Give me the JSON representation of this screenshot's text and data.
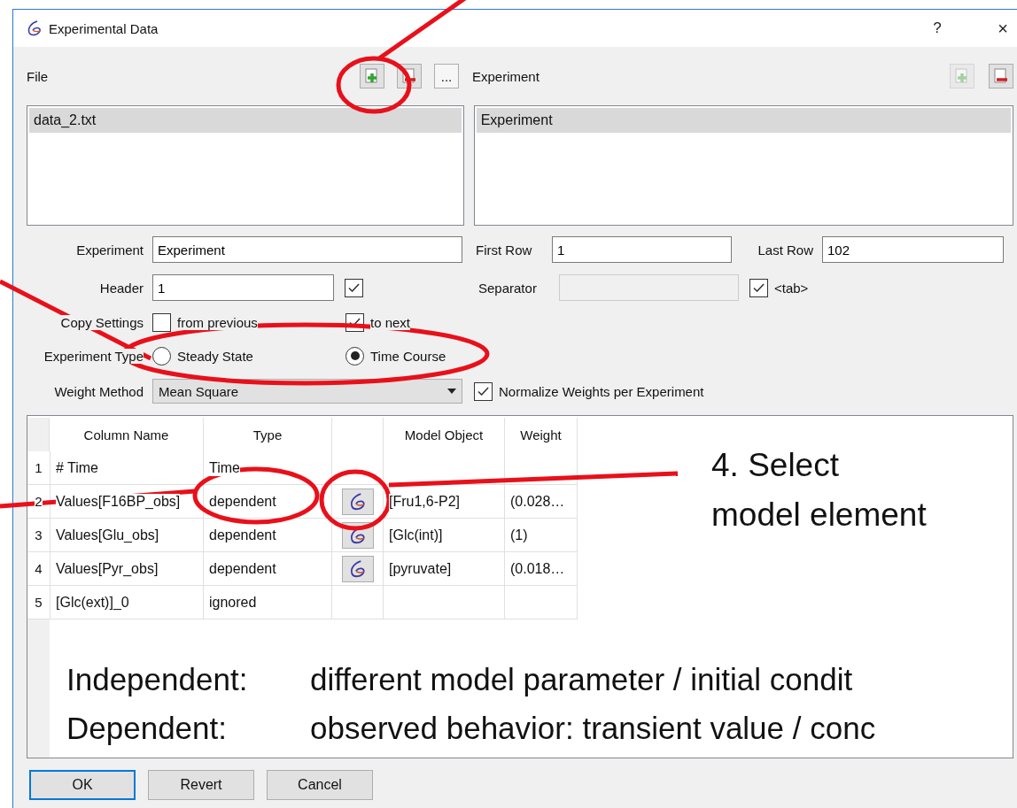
{
  "window": {
    "title": "Experimental Data",
    "help": "?",
    "close": "×"
  },
  "file_section": {
    "label": "File",
    "more_button": "...",
    "add_disabled": false,
    "remove_disabled": false,
    "files": [
      {
        "name": "data_2.txt",
        "selected": true
      }
    ]
  },
  "experiment_section": {
    "label": "Experiment",
    "add_disabled": true,
    "remove_disabled": false,
    "experiments": [
      {
        "name": "Experiment",
        "selected": true
      }
    ]
  },
  "settings": {
    "experiment_label": "Experiment",
    "experiment": "Experiment",
    "first_row_label": "First Row",
    "first_row": "1",
    "last_row_label": "Last Row",
    "last_row": "102",
    "header_label": "Header",
    "header": "1",
    "header_checked": true,
    "separator_label": "Separator",
    "separator_disabled": true,
    "tab_checked": true,
    "tab_label": "<tab>",
    "copy_label": "Copy Settings",
    "from_previous_label": "from previous",
    "from_previous": false,
    "to_next_label": "to next",
    "to_next": true,
    "type_label": "Experiment Type",
    "types": [
      {
        "label": "Steady State",
        "selected": false
      },
      {
        "label": "Time Course",
        "selected": true
      }
    ],
    "weight_label": "Weight Method",
    "weight_method": "Mean Square",
    "normalize_label": "Normalize Weights per Experiment",
    "normalize": true
  },
  "table": {
    "columns": [
      "Column Name",
      "Type",
      "Model Object",
      "Weight"
    ],
    "rows": [
      {
        "index": "1",
        "name": "# Time",
        "type": "Time",
        "picker": false
      },
      {
        "index": "2",
        "name": "Values[F16BP_obs]",
        "type": "dependent",
        "picker": true,
        "model_object": "[Fru1,6-P2]",
        "weight": "(0.028…"
      },
      {
        "index": "3",
        "name": "Values[Glu_obs]",
        "type": "dependent",
        "picker": true,
        "model_object": "[Glc(int)]",
        "weight": "(1)"
      },
      {
        "index": "4",
        "name": "Values[Pyr_obs]",
        "type": "dependent",
        "picker": true,
        "model_object": "[pyruvate]",
        "weight": "(0.018…"
      },
      {
        "index": "5",
        "name": "[Glc(ext)]_0",
        "type": "ignored",
        "picker": false
      }
    ]
  },
  "buttons": [
    {
      "label": "OK",
      "focused": true
    },
    {
      "label": "Revert",
      "focused": false
    },
    {
      "label": "Cancel",
      "focused": false
    }
  ],
  "annotations": {
    "callout": [
      "4. Select",
      "model element"
    ],
    "notes": [
      {
        "term": "Independent:",
        "text": "different model parameter / initial condit"
      },
      {
        "term": "Dependent:",
        "text": "observed behavior: transient value / conc"
      }
    ]
  }
}
